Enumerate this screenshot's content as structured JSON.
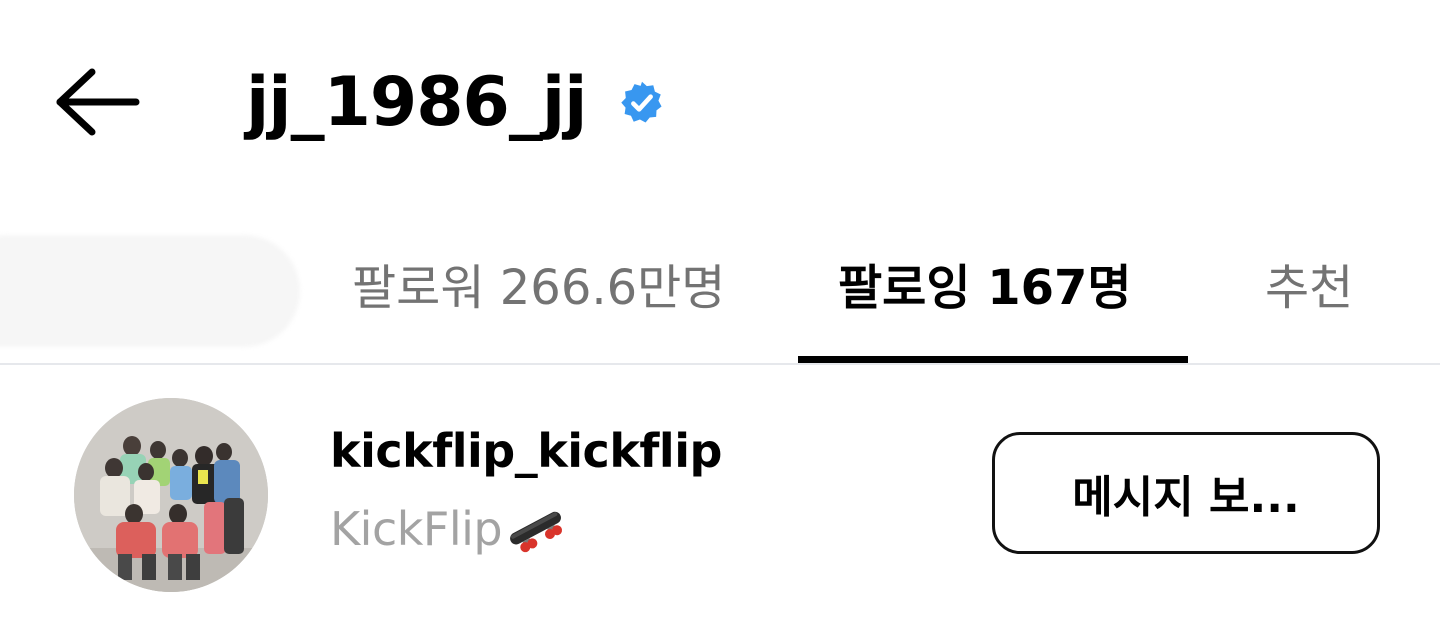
{
  "header": {
    "back_icon": "arrow-left-icon",
    "title": "jj_1986_jj",
    "verified_icon": "verified-badge-icon",
    "verified_color": "#3897f0"
  },
  "tabs": [
    {
      "label": "팔로워 266.6만명",
      "active": false
    },
    {
      "label": "팔로잉 167명",
      "active": true
    },
    {
      "label": "추천",
      "active": false
    }
  ],
  "colors": {
    "active_tab": "#000000",
    "inactive_tab": "#737373",
    "secondary_text": "#a3a3a3"
  },
  "following_list": [
    {
      "username": "kickflip_kickflip",
      "full_name": "KickFlip",
      "emoji_icon": "skateboard-icon",
      "action_label": "메시지 보..."
    }
  ]
}
